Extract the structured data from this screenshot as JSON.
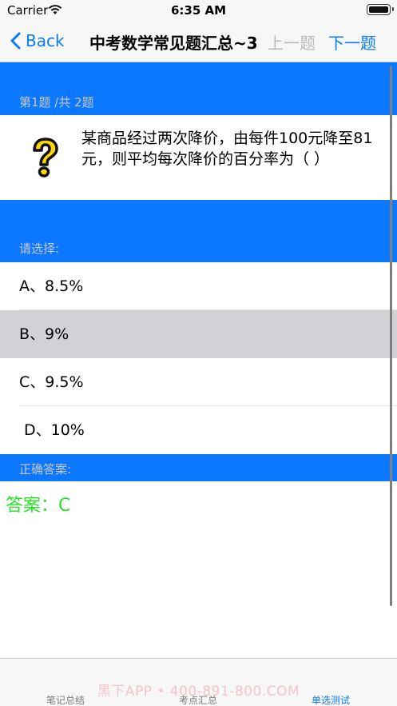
{
  "status_bar": {
    "carrier": "Carrier",
    "time": "6:35 AM"
  },
  "nav": {
    "back_label": "Back",
    "title": "中考数学常见题汇总~3",
    "prev_label": "上一题",
    "next_label": "下一题"
  },
  "question": {
    "progress_label": "第1题 /共 2题",
    "text": "某商品经过两次降价，由每件100元降至81元，则平均每次降价的百分率为（    ）",
    "icon": "question-mark-icon"
  },
  "options_section": {
    "label": "请选择:",
    "options": [
      {
        "text": "A、8.5%"
      },
      {
        "text": "B、9%"
      },
      {
        "text": "C、9.5%"
      },
      {
        "text": "D、10%"
      }
    ],
    "selected_index": 1
  },
  "answer_section": {
    "label": "正确答案:",
    "answer": "答案：C"
  },
  "tab_bar": {
    "tabs": [
      {
        "label": "笔记总结"
      },
      {
        "label": "考点汇总"
      },
      {
        "label": "单选测试"
      }
    ],
    "active_index": 2,
    "watermark": "黑下APP • 400-891-800.COM"
  },
  "colors": {
    "accent": "#0a7aff",
    "band": "#0b78ff",
    "answer": "#2be02b",
    "selected_row": "#d1d1d6"
  }
}
